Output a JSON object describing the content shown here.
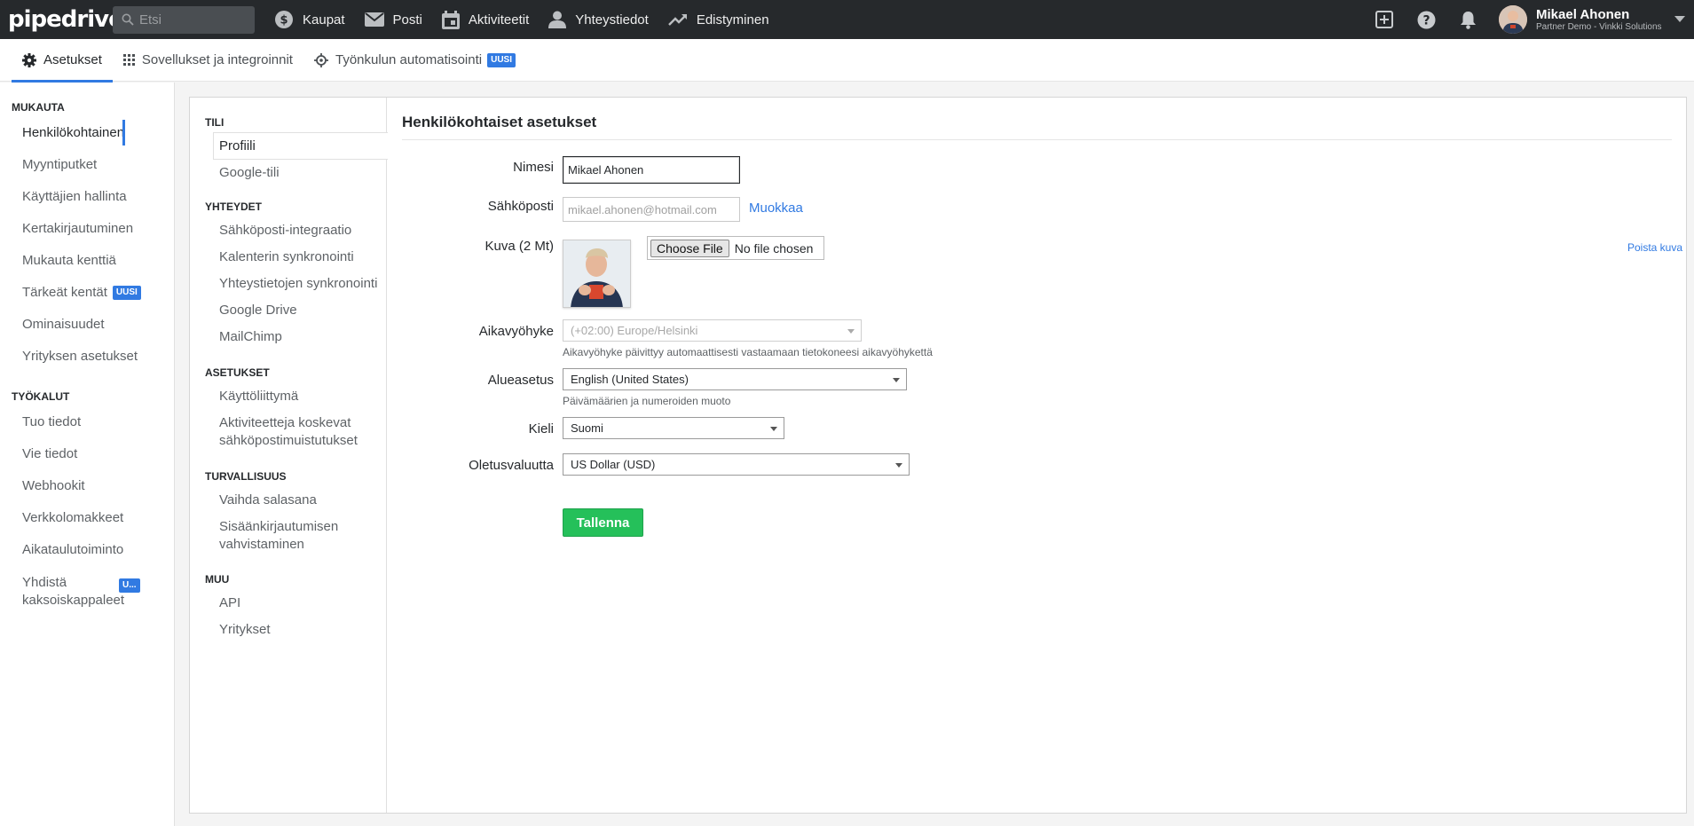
{
  "topbar": {
    "logo": "pipedrive",
    "search_placeholder": "Etsi",
    "nav": [
      "Kaupat",
      "Posti",
      "Aktiviteetit",
      "Yhteystiedot",
      "Edistyminen"
    ],
    "user_name": "Mikael Ahonen",
    "user_company": "Partner Demo - Vinkki Solutions"
  },
  "tabs": {
    "settings": "Asetukset",
    "apps": "Sovellukset ja integroinnit",
    "automation": "Työnkulun automatisointi",
    "new_badge": "UUSI"
  },
  "sidebar": {
    "section1": "MUKAUTA",
    "items1": [
      "Henkilökohtainen",
      "Myyntiputket",
      "Käyttäjien hallinta",
      "Kertakirjautuminen",
      "Mukauta kenttiä",
      "Tärkeät kentät",
      "Ominaisuudet",
      "Yrityksen asetukset"
    ],
    "new_badge": "UUSI",
    "section2": "TYÖKALUT",
    "items2": [
      "Tuo tiedot",
      "Vie tiedot",
      "Webhookit",
      "Verkkolomakkeet",
      "Aikataulutoiminto"
    ],
    "merge_line1": "Yhdistä",
    "merge_line2": "kaksoiskappaleet",
    "merge_badge": "U..."
  },
  "subnav": {
    "sec_tili": "TILI",
    "profiili": "Profiili",
    "google_tili": "Google-tili",
    "sec_yhteydet": "YHTEYDET",
    "yhteydet": [
      "Sähköposti-integraatio",
      "Kalenterin synkronointi",
      "Yhteystietojen synkronointi",
      "Google Drive",
      "MailChimp"
    ],
    "sec_asetukset": "ASETUKSET",
    "kayttoliittyma": "Käyttöliittymä",
    "aktiviteetit_1": "Aktiviteetteja koskevat",
    "aktiviteetit_2": "sähköpostimuistutukset",
    "sec_turvallisuus": "TURVALLISUUS",
    "vaihda": "Vaihda salasana",
    "sisaan_1": "Sisäänkirjautumisen",
    "sisaan_2": "vahvistaminen",
    "sec_muu": "MUU",
    "api": "API",
    "yritykset": "Yritykset"
  },
  "form": {
    "title": "Henkilökohtaiset asetukset",
    "name_label": "Nimesi",
    "name_value": "Mikael Ahonen",
    "email_label": "Sähköposti",
    "email_value": "mikael.ahonen@hotmail.com",
    "email_edit": "Muokkaa",
    "photo_label": "Kuva (2 Mt)",
    "file_button": "Choose File",
    "file_status": "No file chosen",
    "remove_photo": "Poista kuva",
    "tz_label": "Aikavyöhyke",
    "tz_value": "(+02:00) Europe/Helsinki",
    "tz_hint": "Aikavyöhyke päivittyy automaattisesti vastaamaan tietokoneesi aikavyöhykettä",
    "locale_label": "Alueasetus",
    "locale_value": "English (United States)",
    "locale_hint": "Päivämäärien ja numeroiden muoto",
    "lang_label": "Kieli",
    "lang_value": "Suomi",
    "currency_label": "Oletusvaluutta",
    "currency_value": "US Dollar (USD)",
    "save": "Tallenna"
  }
}
